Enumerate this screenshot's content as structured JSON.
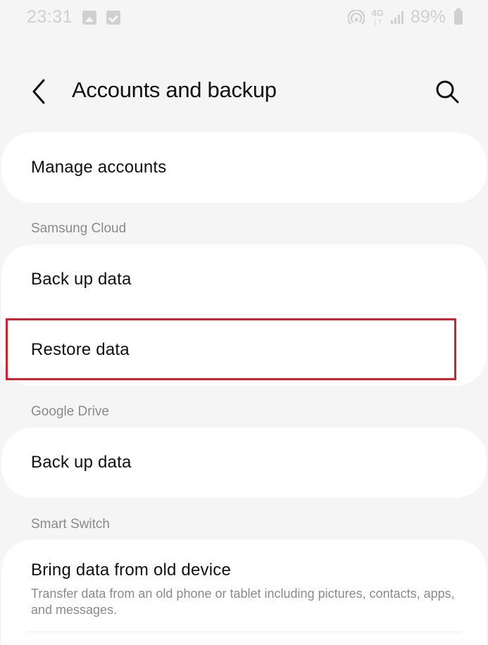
{
  "status_bar": {
    "time": "23:31",
    "network_top": "4G",
    "network_bottom": "↓↑",
    "battery": "89%",
    "color": "#d0d0d0"
  },
  "header": {
    "title": "Accounts and backup"
  },
  "sections": {
    "manage": {
      "label": "Manage accounts"
    },
    "samsung_cloud": {
      "header": "Samsung Cloud",
      "backup_label": "Back up data",
      "restore_label": "Restore data"
    },
    "google_drive": {
      "header": "Google Drive",
      "backup_label": "Back up data"
    },
    "smart_switch": {
      "header": "Smart Switch",
      "title": "Bring data from old device",
      "subtitle": "Transfer data from an old phone or tablet including pictures, contacts, apps, and messages."
    }
  },
  "colors": {
    "background": "#f5f5f5",
    "card": "#ffffff",
    "highlight": "#d3222f",
    "secondary_text": "#8a8a8a"
  },
  "icons": {
    "back": "chevron-left-icon",
    "search": "search-icon",
    "gallery": "gallery-icon",
    "check": "checkbox-icon",
    "hotspot": "hotspot-icon",
    "signal": "signal-icon",
    "battery": "battery-icon"
  }
}
